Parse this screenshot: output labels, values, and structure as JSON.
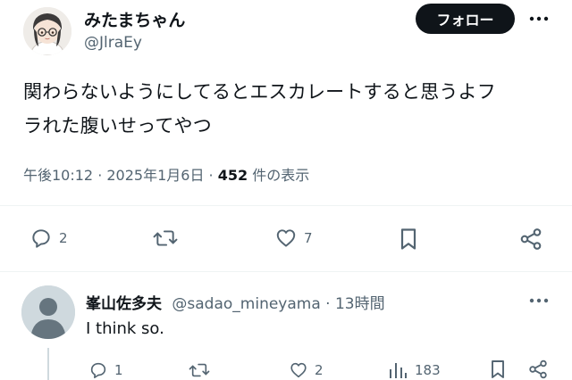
{
  "tweet": {
    "author_name": "みたまちゃん",
    "author_handle": "@JlraEy",
    "follow_label": "フォロー",
    "text_line1": "関わらないようにしてるとエスカレートすると思うよフ",
    "text_line2": "ラれた腹いせってやつ",
    "timestamp": "午後10:12 · 2025年1月6日 ·",
    "views_count": "452",
    "views_label": "件の表示",
    "actions": {
      "reply_count": "2",
      "retweet_count": "",
      "like_count": "7"
    }
  },
  "reply": {
    "author_name": "峯山佐多夫",
    "author_handle": "@sadao_mineyama",
    "separator": " · ",
    "time": "13時間",
    "text": "I think so.",
    "actions": {
      "reply_count": "1",
      "retweet_count": "",
      "like_count": "2",
      "views_count": "183"
    }
  },
  "colors": {
    "text_primary": "#0f1419",
    "text_secondary": "#536471",
    "follow_bg": "#0f1419",
    "divider": "#eff3f4",
    "avatar_placeholder": "#cfd9de"
  },
  "icons": [
    "more-icon",
    "reply-icon",
    "retweet-icon",
    "like-icon",
    "bookmark-icon",
    "share-icon",
    "views-icon"
  ]
}
